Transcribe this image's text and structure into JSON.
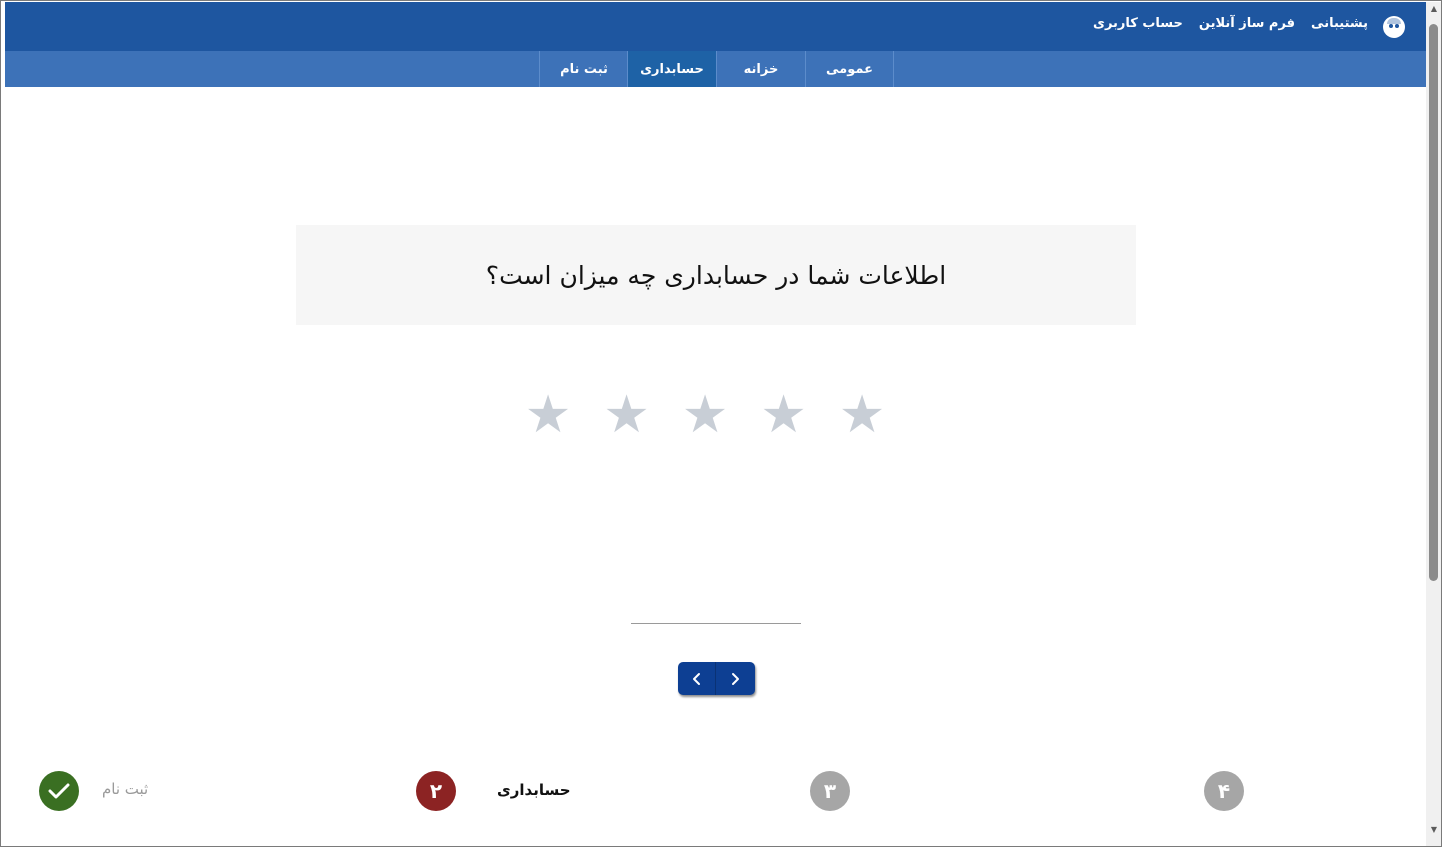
{
  "header": {
    "links": [
      {
        "label": "حساب کاربری"
      },
      {
        "label": "فرم ساز آنلاین"
      },
      {
        "label": "پشتیبانی"
      }
    ]
  },
  "tabs": [
    {
      "label": "عمومی",
      "active": false
    },
    {
      "label": "خزانه",
      "active": false
    },
    {
      "label": "حسابداری",
      "active": true
    },
    {
      "label": "ثبت نام",
      "active": false
    }
  ],
  "question": {
    "text": "اطلاعات شما در حسابداری چه میزان است؟"
  },
  "rating": {
    "max": 5,
    "value": 0,
    "star_glyph": "★"
  },
  "steps": [
    {
      "number": "",
      "label": "ثبت نام",
      "status": "done",
      "color": "#3a6f22"
    },
    {
      "number": "۲",
      "label": "حسابداری",
      "status": "current",
      "color": "#8c2323"
    },
    {
      "number": "۳",
      "label": "",
      "status": "pending",
      "color": "#a6a6a6"
    },
    {
      "number": "۴",
      "label": "",
      "status": "pending",
      "color": "#a6a6a6"
    }
  ],
  "colors": {
    "header_bg": "#1e56a0",
    "tabs_bg": "#3d72b8",
    "nav_button_bg": "#0d3f93"
  }
}
